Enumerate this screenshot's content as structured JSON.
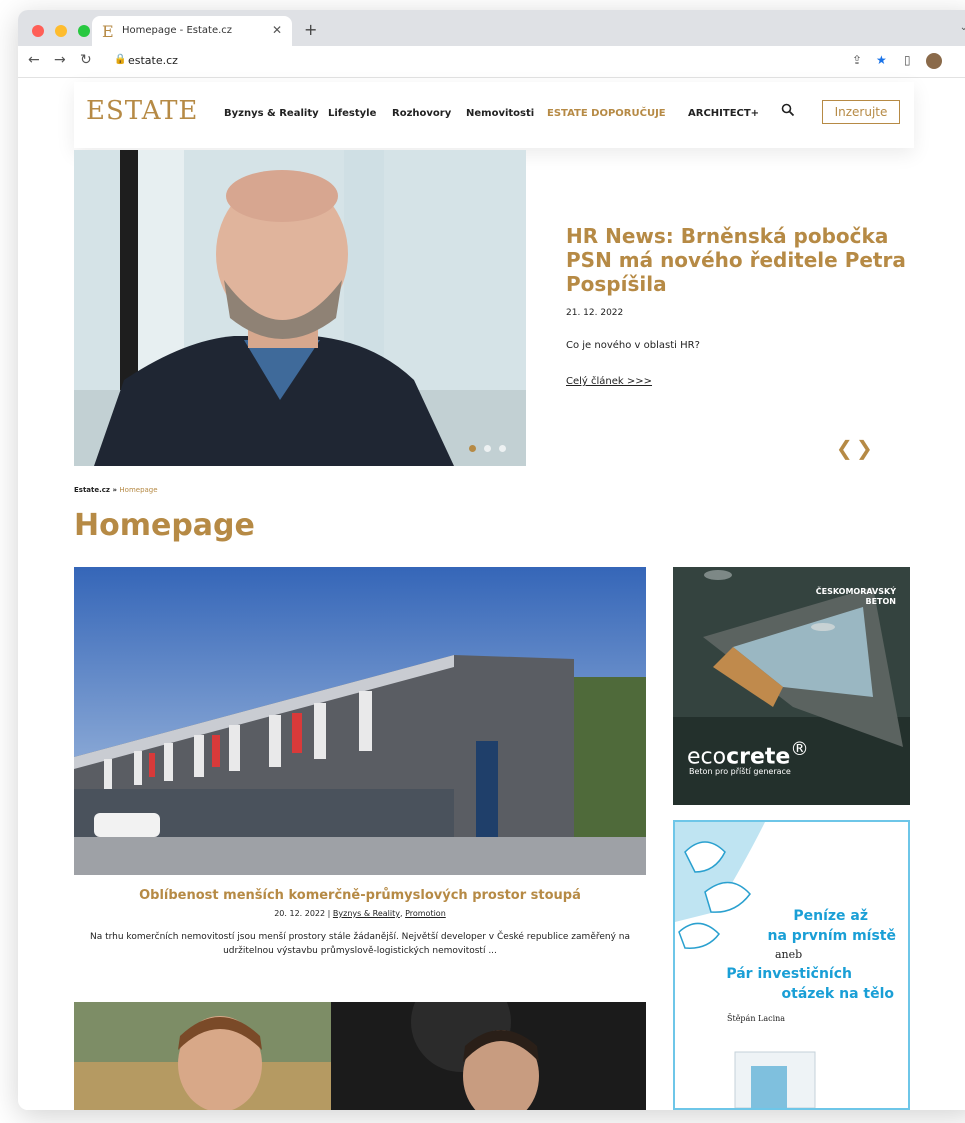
{
  "browser": {
    "tab_title": "Homepage - Estate.cz",
    "favicon_letter": "E",
    "url": "estate.cz"
  },
  "site": {
    "logo": "ESTATE",
    "menu": [
      {
        "label": "Byznys & Reality"
      },
      {
        "label": "Lifestyle"
      },
      {
        "label": "Rozhovory"
      },
      {
        "label": "Nemovitosti"
      },
      {
        "label": "ESTATE DOPORUČUJE"
      },
      {
        "label": "ARCHITECT+"
      }
    ],
    "cta_label": "Inzerujte",
    "accent_color": "#b68a45"
  },
  "hero": {
    "title": "HR News: Brněnská pobočka PSN má nového ředitele Petra Pospíšila",
    "date": "21. 12. 2022",
    "excerpt": "Co je nového v oblasti HR?",
    "link": "Celý článek >>>",
    "prev_arrow": "❮",
    "next_arrow": "❯",
    "slides": 3,
    "active_slide": 1
  },
  "breadcrumb": {
    "root": "Estate.cz",
    "separator": "»",
    "current": "Homepage"
  },
  "page_title": "Homepage",
  "feature": {
    "title": "Oblíbenost menších komerčně-průmyslových prostor stoupá",
    "date": "20. 12. 2022",
    "separator": "|",
    "category1": "Byznys & Reality",
    "category2": "Promotion",
    "excerpt": "Na trhu komerčních nemovitostí jsou menší prostory stále žádanější. Největší developer v České republice zaměřený na udržitelnou výstavbu průmyslově-logistických nemovitostí ..."
  },
  "ads": {
    "ad1": {
      "brand": "ČESKOMORAVSKÝ BETON",
      "logo_light": "eco",
      "logo_bold": "crete",
      "logo_mark": "®",
      "tagline": "Beton pro příští generace"
    },
    "ad2": {
      "line1": "Peníze až",
      "line2": "na prvním místě",
      "aneb": "aneb",
      "line3": "Pár investičních",
      "line4": "otázek na tělo",
      "author": "Štěpán Lacina"
    }
  }
}
